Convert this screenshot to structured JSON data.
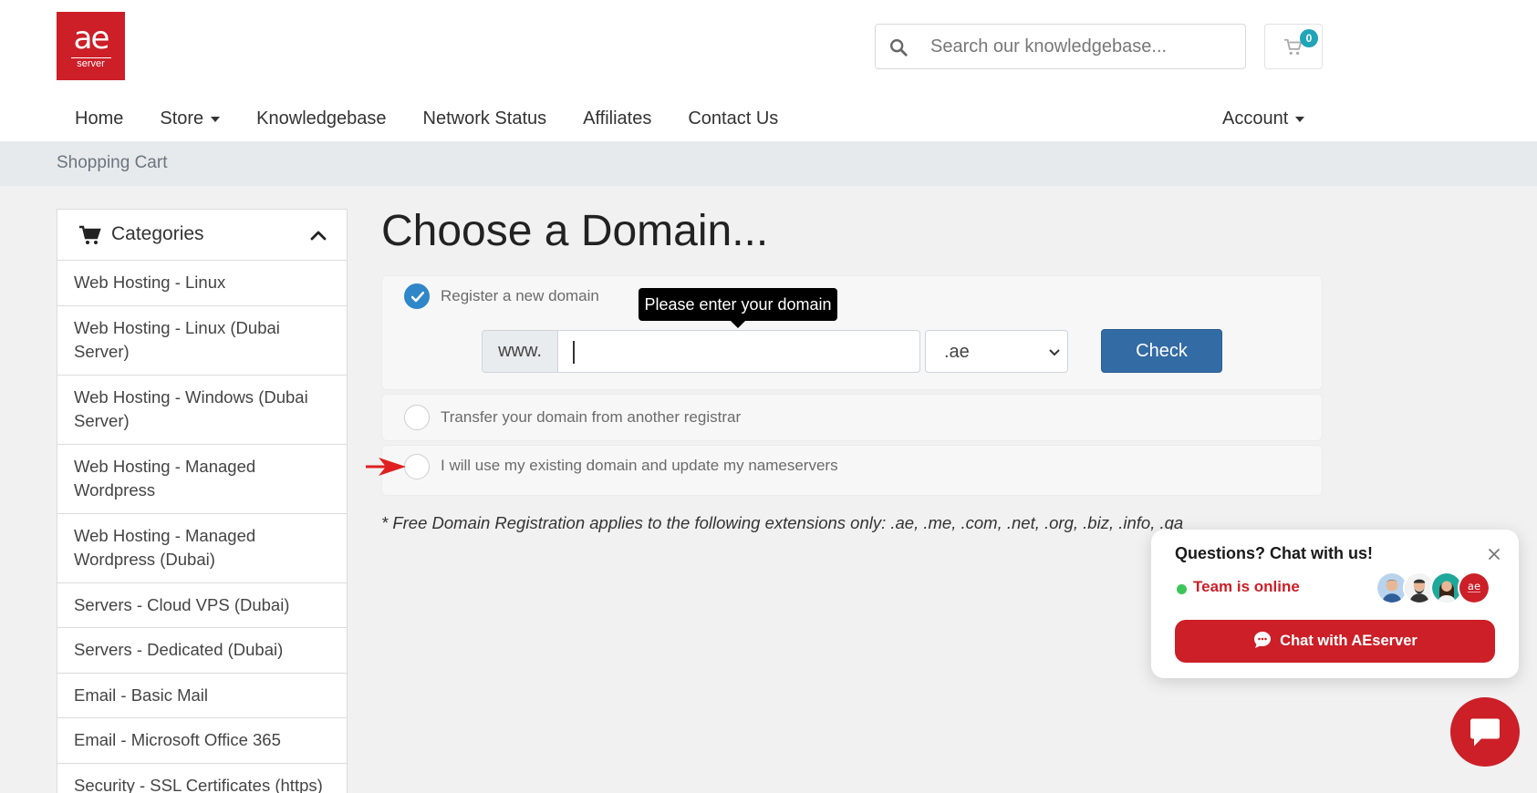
{
  "brand": {
    "logo_text": "ae",
    "logo_subtext": "server",
    "color": "#cc1f27"
  },
  "header": {
    "search_placeholder": "Search our knowledgebase...",
    "cart_count": "0"
  },
  "nav": {
    "items": [
      {
        "label": "Home",
        "has_dropdown": false
      },
      {
        "label": "Store",
        "has_dropdown": true
      },
      {
        "label": "Knowledgebase",
        "has_dropdown": false
      },
      {
        "label": "Network Status",
        "has_dropdown": false
      },
      {
        "label": "Affiliates",
        "has_dropdown": false
      },
      {
        "label": "Contact Us",
        "has_dropdown": false
      }
    ],
    "account_label": "Account"
  },
  "breadcrumb": "Shopping Cart",
  "sidebar": {
    "title": "Categories",
    "items": [
      "Web Hosting - Linux",
      "Web Hosting - Linux (Dubai Server)",
      "Web Hosting - Windows (Dubai Server)",
      "Web Hosting - Managed Wordpress",
      "Web Hosting - Managed Wordpress (Dubai)",
      "Servers - Cloud VPS (Dubai)",
      "Servers - Dedicated (Dubai)",
      "Email - Basic Mail",
      "Email - Microsoft Office 365",
      "Security - SSL Certificates (https)"
    ]
  },
  "main": {
    "title": "Choose a Domain...",
    "options": {
      "register": "Register a new domain",
      "transfer": "Transfer your domain from another registrar",
      "existing": "I will use my existing domain and update my nameservers"
    },
    "www_prefix": "www.",
    "tld_selected": ".ae",
    "check_label": "Check",
    "tooltip": "Please enter your domain",
    "note": "* Free Domain Registration applies to the following extensions only: .ae, .me, .com, .net, .org, .biz, .info, .qa"
  },
  "chat": {
    "title": "Questions? Chat with us!",
    "status": "Team is online",
    "button_label": "Chat with AEserver"
  },
  "colors": {
    "primary_button": "#336ba5",
    "accent": "#cc1f27",
    "radio_checked": "#2f86c8",
    "badge": "#1fa4b8",
    "online": "#3bc55a"
  }
}
